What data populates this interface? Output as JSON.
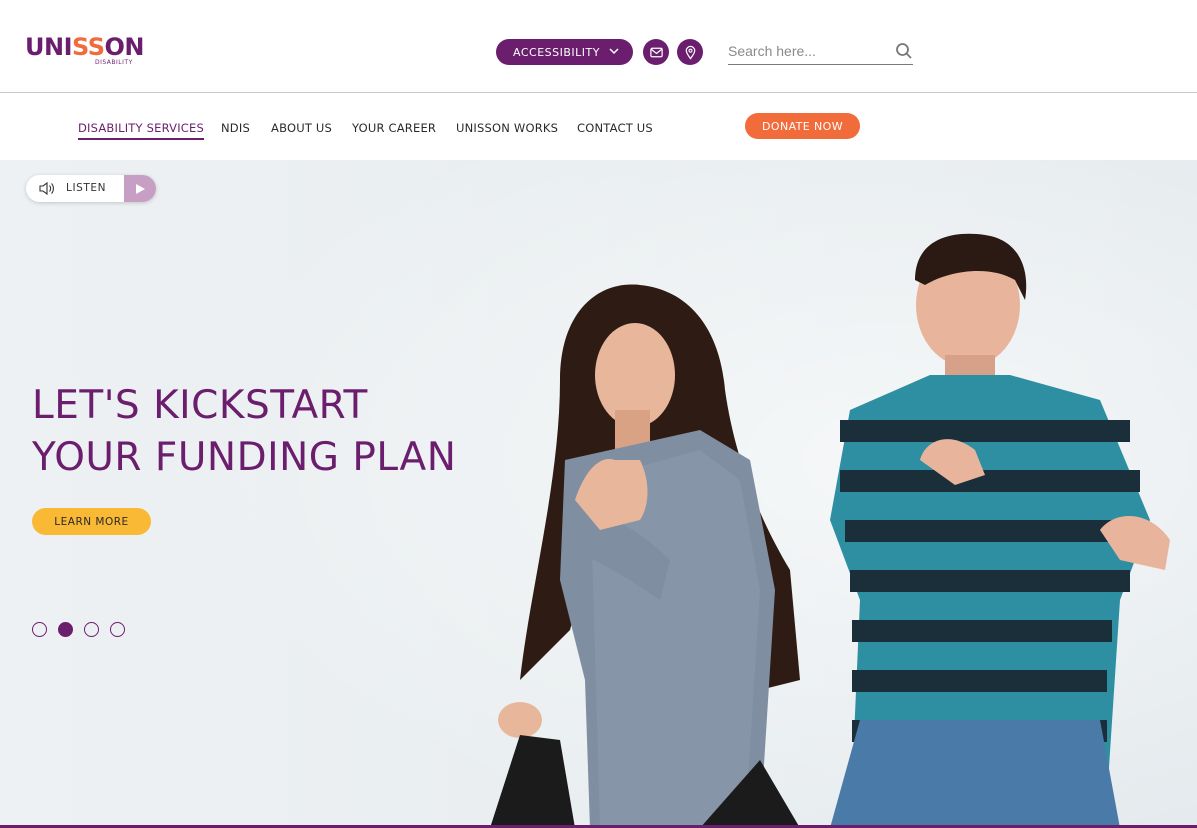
{
  "brand": {
    "name_a": "UNI",
    "name_b": "SS",
    "name_c": "ON",
    "sub": "DISABILITY",
    "primary_color": "#6b1e6e",
    "accent_color": "#f26b3a",
    "cta_color": "#f9b934"
  },
  "header": {
    "accessibility_label": "ACCESSIBILITY",
    "mail_icon": "mail-icon",
    "location_icon": "location-pin-icon",
    "search_placeholder": "Search here..."
  },
  "nav": {
    "items": [
      {
        "label": "DISABILITY SERVICES",
        "active": true
      },
      {
        "label": "NDIS",
        "active": false
      },
      {
        "label": "ABOUT US",
        "active": false
      },
      {
        "label": "YOUR CAREER",
        "active": false
      },
      {
        "label": "UNISSON WORKS",
        "active": false
      },
      {
        "label": "CONTACT US",
        "active": false
      }
    ],
    "donate_label": "DONATE NOW"
  },
  "hero": {
    "listen_label": "LISTEN",
    "headline_line1": "LET'S KICKSTART",
    "headline_line2": "YOUR FUNDING PLAN",
    "cta_label": "LEARN MORE",
    "slide_count": 4,
    "active_slide": 2
  }
}
